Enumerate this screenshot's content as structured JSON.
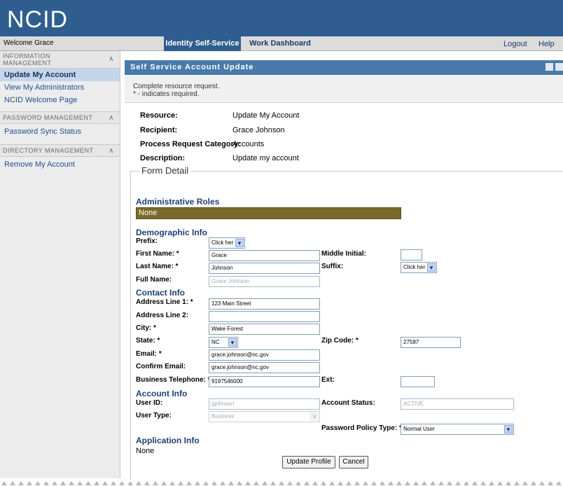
{
  "app": {
    "logo": "NCID"
  },
  "nav": {
    "welcome": "Welcome Grace",
    "tabs": [
      "Identity Self-Service",
      "Work Dashboard"
    ],
    "logout": "Logout",
    "help": "Help"
  },
  "sidebar": {
    "sections": [
      {
        "title_line1": "INFORMATION",
        "title_line2": "MANAGEMENT",
        "items": [
          "Update My Account",
          "View My Administrators",
          "NCID Welcome Page"
        ]
      },
      {
        "title": "PASSWORD MANAGEMENT",
        "items": [
          "Password Sync Status"
        ]
      },
      {
        "title": "DIRECTORY MANAGEMENT",
        "items": [
          "Remove My Account"
        ]
      }
    ]
  },
  "panel": {
    "title": "Self Service Account Update",
    "intro_line1": "Complete resource request.",
    "intro_line2": "* - indicates required."
  },
  "summary": {
    "resource_label": "Resource:",
    "resource": "Update My Account",
    "recipient_label": "Recipient:",
    "recipient": "Grace Johnson",
    "category_label": "Process Request Category:",
    "category": "Accounts",
    "description_label": "Description:",
    "description": "Update my account"
  },
  "form": {
    "legend": "Form Detail",
    "admin_roles_title": "Administrative Roles",
    "admin_roles_value": "None",
    "demographic_title": "Demographic Info",
    "prefix_label": "Prefix:",
    "prefix_value": "Click her",
    "first_name_label": "First Name: *",
    "first_name": "Grace",
    "middle_initial_label": "Middle Initial:",
    "middle_initial": "",
    "last_name_label": "Last Name: *",
    "last_name": "Johnson",
    "suffix_label": "Suffix:",
    "suffix_value": "Click her",
    "full_name_label": "Full Name:",
    "full_name": "Grace Johnson",
    "contact_title": "Contact Info",
    "address1_label": "Address Line 1: *",
    "address1": "123 Main Street",
    "address2_label": "Address Line 2:",
    "address2": "",
    "city_label": "City: *",
    "city": "Wake Forest",
    "state_label": "State: *",
    "state": "NC",
    "zip_label": "Zip Code: *",
    "zip": "27587",
    "email_label": "Email: *",
    "email": "grace.johnson@nc.gov",
    "confirm_email_label": "Confirm Email:",
    "confirm_email": "grace.johnson@nc.gov",
    "phone_label": "Business Telephone: *",
    "phone": "9197546000",
    "ext_label": "Ext:",
    "ext": "",
    "account_title": "Account Info",
    "userid_label": "User ID:",
    "userid": "gjohnson",
    "status_label": "Account Status:",
    "status": "ACTIVE",
    "usertype_label": "User Type:",
    "usertype": "Business",
    "policy_label": "Password Policy Type: *",
    "policy": "Normal User",
    "app_title": "Application Info",
    "app_value": "None",
    "update_button": "Update Profile",
    "cancel_button": "Cancel"
  },
  "colors": {
    "header": "#2f5d8f",
    "panel_title": "#4a7aab",
    "link": "#1f4f8f",
    "section_heading": "#1f3f75"
  }
}
